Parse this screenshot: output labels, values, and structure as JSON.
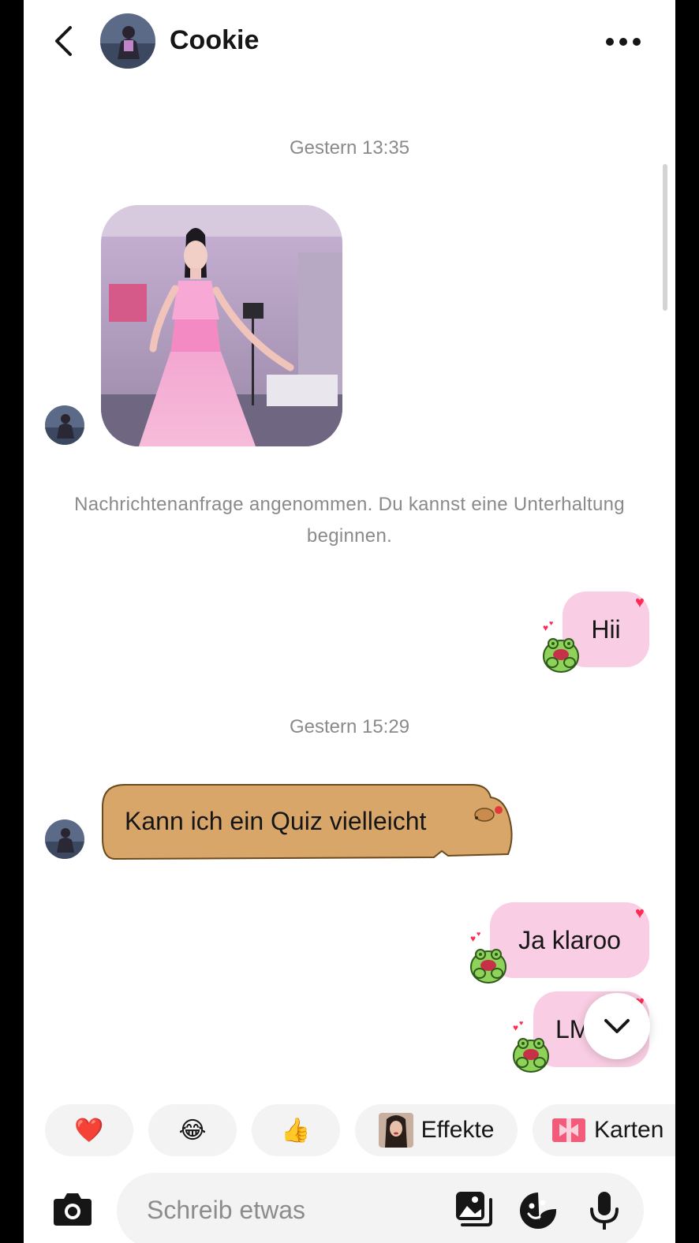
{
  "header": {
    "contact_name": "Cookie"
  },
  "messages": {
    "timestamp_1": "Gestern 13:35",
    "system_message": "Nachrichtenanfrage angenommen. Du kannst eine Unterhaltung beginnen.",
    "msg_hii": "Hii",
    "timestamp_2": "Gestern 15:29",
    "msg_quiz": "Kann ich ein Quiz vielleicht",
    "msg_ja": "Ja klaroo",
    "msg_lm": "LM"
  },
  "quick_replies": {
    "heart_emoji": "❤️",
    "laugh_emoji": "😂",
    "thumbs_emoji": "👍",
    "effects_label": "Effekte",
    "cards_label": "Karten"
  },
  "composer": {
    "placeholder": "Schreib etwas"
  },
  "colors": {
    "bubble_me": "#f9cde3",
    "bubble_other": "#d9a66a",
    "heart": "#ff2b54"
  }
}
